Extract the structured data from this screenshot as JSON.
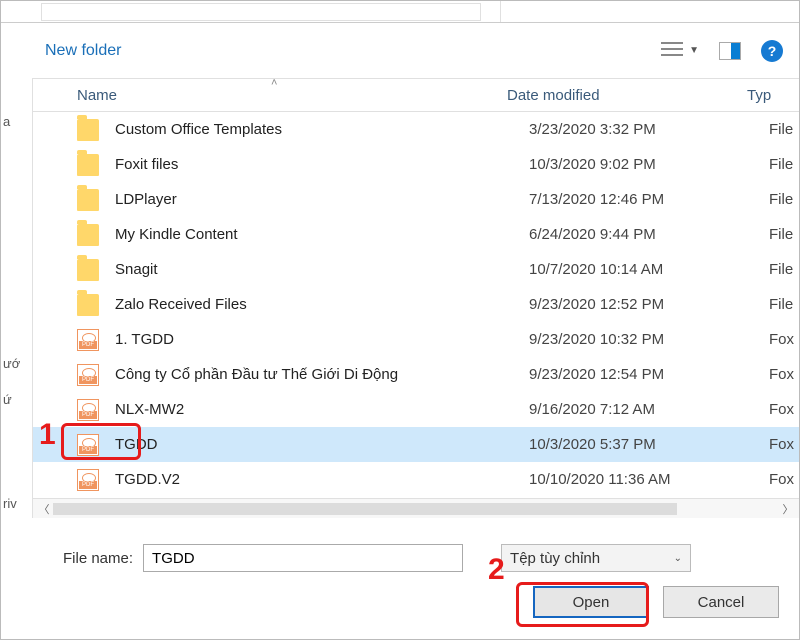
{
  "toolbar": {
    "new_folder": "New folder"
  },
  "columns": {
    "name": "Name",
    "date": "Date modified",
    "type": "Typ"
  },
  "left_labels": {
    "a": "a",
    "uoc": "ướ",
    "ung": "ứ",
    "riv": "riv"
  },
  "rows": [
    {
      "kind": "folder",
      "name": "Custom Office Templates",
      "date": "3/23/2020 3:32 PM",
      "type": "File"
    },
    {
      "kind": "folder",
      "name": "Foxit files",
      "date": "10/3/2020 9:02 PM",
      "type": "File"
    },
    {
      "kind": "folder",
      "name": "LDPlayer",
      "date": "7/13/2020 12:46 PM",
      "type": "File"
    },
    {
      "kind": "folder",
      "name": "My Kindle Content",
      "date": "6/24/2020 9:44 PM",
      "type": "File"
    },
    {
      "kind": "folder",
      "name": "Snagit",
      "date": "10/7/2020 10:14 AM",
      "type": "File"
    },
    {
      "kind": "folder",
      "name": "Zalo Received Files",
      "date": "9/23/2020 12:52 PM",
      "type": "File"
    },
    {
      "kind": "pdf",
      "name": "1. TGDD",
      "date": "9/23/2020 10:32 PM",
      "type": "Fox"
    },
    {
      "kind": "pdf",
      "name": "Công ty Cổ phần Đầu tư Thế Giới Di Động",
      "date": "9/23/2020 12:54 PM",
      "type": "Fox"
    },
    {
      "kind": "pdf",
      "name": "NLX-MW2",
      "date": "9/16/2020 7:12 AM",
      "type": "Fox"
    },
    {
      "kind": "pdf",
      "name": "TGDD",
      "date": "10/3/2020 5:37 PM",
      "type": "Fox",
      "selected": true
    },
    {
      "kind": "pdf",
      "name": "TGDD.V2",
      "date": "10/10/2020 11:36 AM",
      "type": "Fox"
    }
  ],
  "filename": {
    "label": "File name:",
    "value": "TGDD"
  },
  "filter": {
    "label": "Tệp tùy chỉnh"
  },
  "buttons": {
    "open": "Open",
    "cancel": "Cancel"
  },
  "annotations": {
    "one": "1",
    "two": "2"
  }
}
